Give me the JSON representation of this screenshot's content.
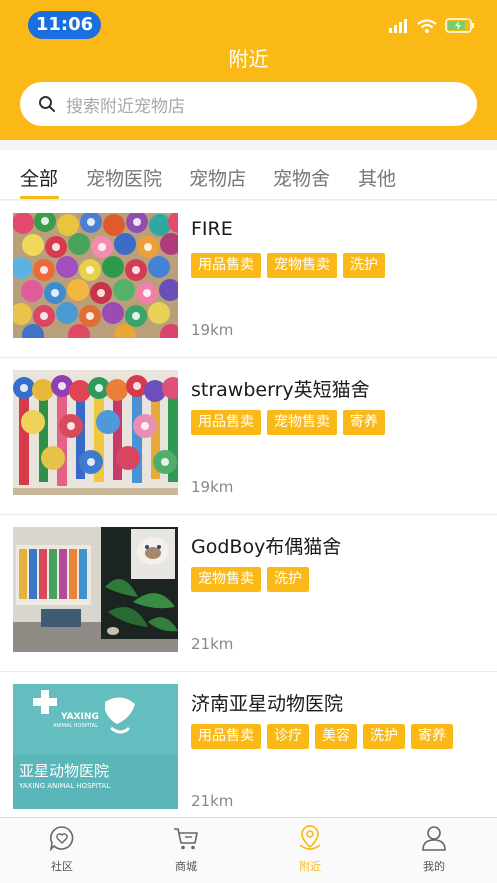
{
  "status": {
    "time": "11:06"
  },
  "header": {
    "title": "附近"
  },
  "search": {
    "placeholder": "搜索附近宠物店"
  },
  "tabs": [
    {
      "label": "全部",
      "active": true
    },
    {
      "label": "宠物医院",
      "active": false
    },
    {
      "label": "宠物店",
      "active": false
    },
    {
      "label": "宠物舍",
      "active": false
    },
    {
      "label": "其他",
      "active": false
    }
  ],
  "stores": [
    {
      "name": "FIRE",
      "tags": [
        "用品售卖",
        "宠物售卖",
        "洗护"
      ],
      "distance": "19km"
    },
    {
      "name": "strawberry英短猫舍",
      "tags": [
        "用品售卖",
        "宠物售卖",
        "寄养"
      ],
      "distance": "19km"
    },
    {
      "name": "GodBoy布偶猫舍",
      "tags": [
        "宠物售卖",
        "洗护"
      ],
      "distance": "21km"
    },
    {
      "name": "济南亚星动物医院",
      "tags": [
        "用品售卖",
        "诊疗",
        "美容",
        "洗护",
        "寄养"
      ],
      "distance": "21km"
    }
  ],
  "thumbnails": {
    "hospital_sign_cn": "亚星动物医院",
    "hospital_sign_en": "YAXING ANIMAL HOSPITAL",
    "hospital_logo_text": "YAXING",
    "hospital_logo_sub": "ANIMAL HOSPITAL"
  },
  "tabbar": [
    {
      "label": "社区",
      "icon": "chat-heart-icon"
    },
    {
      "label": "商城",
      "icon": "cart-icon"
    },
    {
      "label": "附近",
      "icon": "location-pin-icon",
      "active": true
    },
    {
      "label": "我的",
      "icon": "person-icon"
    }
  ],
  "colors": {
    "accent": "#fbb917",
    "time_pill": "#1a6fe0"
  }
}
